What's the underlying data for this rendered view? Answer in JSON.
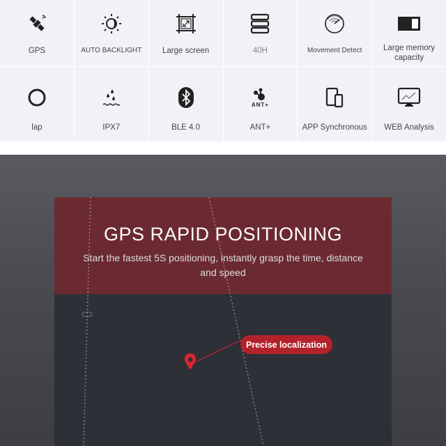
{
  "features": [
    {
      "label": "GPS",
      "icon": "satellite-icon"
    },
    {
      "label": "AUTO BACKLIGHT",
      "icon": "backlight-icon"
    },
    {
      "label": "Large screen",
      "icon": "large-screen-icon"
    },
    {
      "label": "40H",
      "icon": "battery-stack-icon"
    },
    {
      "label": "Movement Detect",
      "icon": "radar-icon"
    },
    {
      "label": "Large memory capacity",
      "icon": "memory-icon"
    },
    {
      "label": "lap",
      "icon": "lap-circle-icon"
    },
    {
      "label": "IPX7",
      "icon": "water-drops-icon"
    },
    {
      "label": "BLE 4.0",
      "icon": "bluetooth-icon"
    },
    {
      "label": "ANT+",
      "icon": "ant-plus-icon",
      "icon_text": "ANT+"
    },
    {
      "label": "APP Synchronous",
      "icon": "devices-icon"
    },
    {
      "label": "WEB Analysis",
      "icon": "monitor-chart-icon"
    }
  ],
  "hero": {
    "title": "GPS RAPID POSITIONING",
    "subtitle": "Start the fastest 5S positioning, instantly grasp the time, distance and speed",
    "callout": "Precise localization",
    "colors": {
      "banner": "#6b2a31",
      "map": "#2e3038",
      "callout": "#b3222a",
      "pin": "#e0242c"
    }
  }
}
